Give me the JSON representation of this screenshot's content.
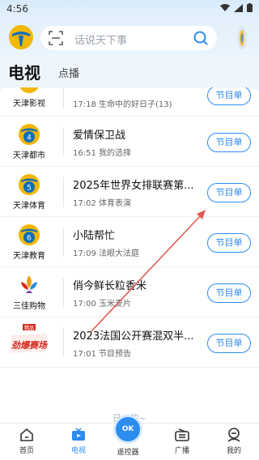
{
  "status_bar": {
    "time": "4:56"
  },
  "header": {
    "search_placeholder": "话说天下事"
  },
  "tabs": {
    "tv": "电视",
    "vod": "点播"
  },
  "schedule_label": "节目单",
  "channels": [
    {
      "name": "天津影视",
      "title": "",
      "time": "17:18",
      "program": "生命中的好日子(13)",
      "logo_color": "#f2b705"
    },
    {
      "name": "天津都市",
      "title": "爱情保卫战",
      "time": "16:51",
      "program": "我的选择",
      "logo_color": "#0d6fb8",
      "num": "4"
    },
    {
      "name": "天津体育",
      "title": "2025年世界女排联赛第...",
      "time": "17:02",
      "program": "体育表演",
      "logo_color": "#0d6fb8",
      "num": "5"
    },
    {
      "name": "天津教育",
      "title": "小陆帮忙",
      "time": "17:09",
      "program": "法眼大法庭",
      "logo_color": "#0d6fb8",
      "num": "6"
    },
    {
      "name": "三佳购物",
      "title": "俏今鲜长粒香米",
      "time": "17:00",
      "program": "玉米麦片",
      "logo_color": "#e8a317"
    },
    {
      "name": "劲爆赛场",
      "title": "2023法国公开赛混双半...",
      "time": "17:01",
      "program": "节目预告",
      "logo_color": "#d62b1f",
      "badge": "精品"
    }
  ],
  "list_footer": "已...的~",
  "bottom_nav": {
    "home": "首页",
    "tv": "电视",
    "remote": "遥控器",
    "remote_ok": "OK",
    "broadcast": "广播",
    "mine": "我的"
  },
  "colors": {
    "accent": "#2d8cf0",
    "arrow": "#e05a4f"
  }
}
